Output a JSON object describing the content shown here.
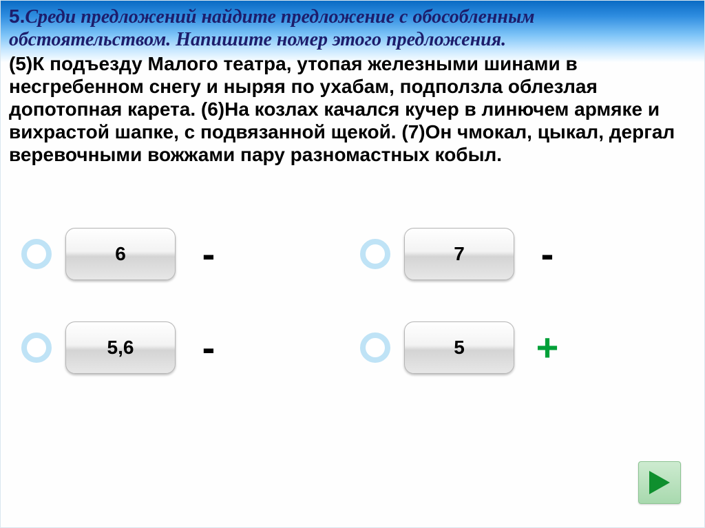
{
  "question": {
    "number": "5.",
    "text": "Среди предложений найдите предложение с обособленным обстоятельством. Напишите номер этого предложения."
  },
  "passage": "(5)К подъезду Малого театра, утопая железными шинами в несгребенном снегу и ныряя по ухабам, подползла облезлая допотопная карета. (6)На козлах качался кучер в линючем армяке и вихрастой шапке, с подвязанной щекой. (7)Он чмокал, цыкал, дергал веревочными вожжами пару разномастных кобыл.",
  "options": [
    {
      "label": "6",
      "mark": "-",
      "correct": false
    },
    {
      "label": "7",
      "mark": "-",
      "correct": false
    },
    {
      "label": "5,6",
      "mark": "-",
      "correct": false
    },
    {
      "label": "5",
      "mark": "+",
      "correct": true
    }
  ],
  "nav": {
    "next": "next"
  }
}
